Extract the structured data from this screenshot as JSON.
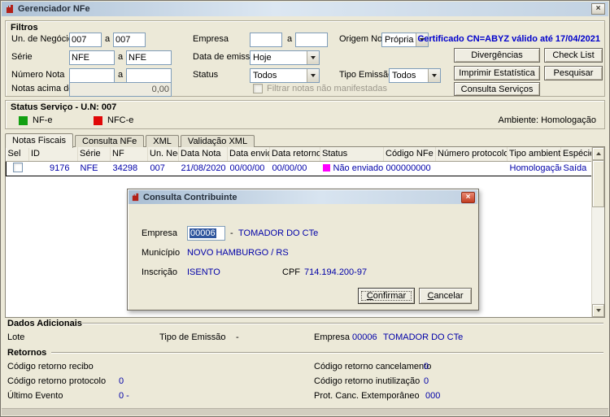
{
  "window": {
    "title": "Gerenciador NFe",
    "close_icon": "×"
  },
  "colors": {
    "value_blue": "#0000A8",
    "certificate_blue": "#0000CC",
    "nfe_green": "#12A012",
    "nfce_red": "#E00808",
    "status_nao_enviado_magenta": "#FF00FF",
    "selection_blue": "#2F569E"
  },
  "filtros": {
    "title": "Filtros",
    "range_sep": "a",
    "un_negocio": {
      "label": "Un. de Negócio",
      "from": "007",
      "to": "007"
    },
    "serie": {
      "label": "Série",
      "from": "NFE",
      "to": "NFE"
    },
    "numero_nota": {
      "label": "Número Nota",
      "from": "",
      "to": ""
    },
    "notas_acima": {
      "label": "Notas acima de",
      "value": "0,00"
    },
    "empresa": {
      "label": "Empresa",
      "from": "",
      "to": ""
    },
    "data_emissao": {
      "label": "Data de emissão",
      "value": "Hoje"
    },
    "status": {
      "label": "Status",
      "value": "Todos"
    },
    "origem_nota": {
      "label": "Origem Nota",
      "value": "Própria"
    },
    "tipo_emissao": {
      "label": "Tipo Emissão",
      "value": "Todos"
    },
    "certificado": "Certificado CN=ABYZ válido até 17/04/2021",
    "filtrar_notas_checkbox": "Filtrar notas não manifestadas",
    "buttons": {
      "divergencias": "Divergências",
      "check_list": "Check List",
      "imprimir_estatistica": "Imprimir Estatística",
      "pesquisar": "Pesquisar",
      "consulta_servicos": "Consulta Serviços"
    }
  },
  "status_servico": {
    "title": "Status Serviço - U.N: 007",
    "nfe": "NF-e",
    "nfce": "NFC-e",
    "ambiente": "Ambiente: Homologação"
  },
  "tabs": [
    {
      "label": "Notas Fiscais",
      "active": true
    },
    {
      "label": "Consulta NFe",
      "active": false
    },
    {
      "label": "XML",
      "active": false
    },
    {
      "label": "Validação XML",
      "active": false
    }
  ],
  "grid": {
    "columns": [
      "Sel",
      "ID",
      "Série",
      "NF",
      "Un. Neg.",
      "Data Nota",
      "Data envio",
      "Data retorno",
      "Status",
      "Código NFe",
      "Número protocolo",
      "Tipo ambiente",
      "Espécie"
    ],
    "row": {
      "id": "9176",
      "serie": "NFE",
      "nf": "34298",
      "un_neg": "007",
      "data_nota": "21/08/2020",
      "data_envio": "00/00/00",
      "data_retorno": "00/00/00",
      "status": "Não enviado",
      "codigo_nfe": "000000000",
      "numero_protocolo": "",
      "tipo_ambiente": "Homologação",
      "especie": "Saída"
    }
  },
  "dialog": {
    "title": "Consulta Contribuinte",
    "close_icon": "×",
    "empresa": {
      "label": "Empresa",
      "value": "00006",
      "sep": "-",
      "name": "TOMADOR DO CTe"
    },
    "municipio": {
      "label": "Município",
      "value": "NOVO HAMBURGO / RS"
    },
    "inscricao": {
      "label": "Inscrição",
      "value": "ISENTO"
    },
    "cpf": {
      "label": "CPF",
      "value": "714.194.200-97"
    },
    "confirmar": "Confirmar",
    "cancelar": "Cancelar"
  },
  "dados_adicionais": {
    "title": "Dados Adicionais",
    "lote_label": "Lote",
    "tipo_emissao_label": "Tipo de Emissão",
    "tipo_emissao_value": "-",
    "empresa_label": "Empresa",
    "empresa_code": "00006",
    "empresa_name": "TOMADOR DO CTe"
  },
  "retornos": {
    "title": "Retornos",
    "recibo": {
      "label": "Código retorno recibo",
      "value": ""
    },
    "protocolo": {
      "label": "Código retorno protocolo",
      "value": "0"
    },
    "ultimo_evento": {
      "label": "Último Evento",
      "value": "0 -"
    },
    "cancelamento": {
      "label": "Código retorno cancelamento",
      "value": "0"
    },
    "inutilizacao": {
      "label": "Código retorno inutilização",
      "value": "0"
    },
    "prot_canc": {
      "label": "Prot. Canc. Extemporâneo",
      "value": "000"
    }
  }
}
